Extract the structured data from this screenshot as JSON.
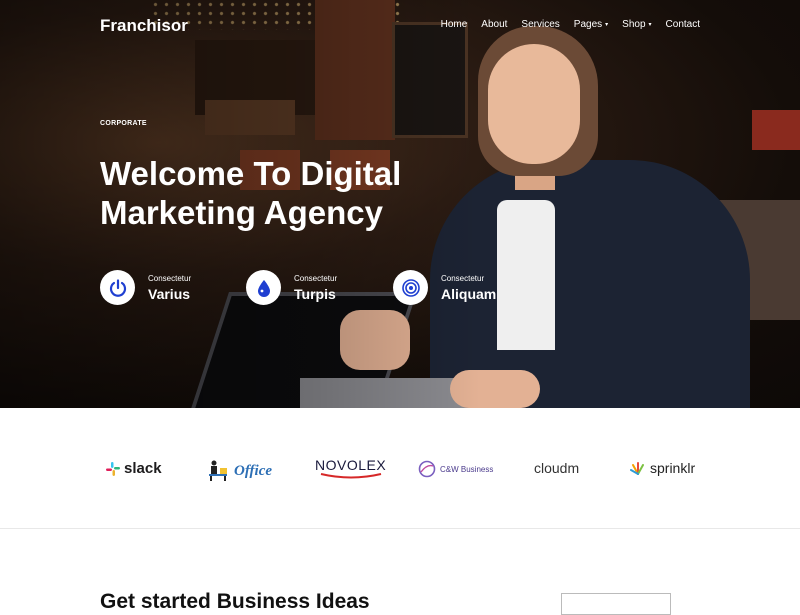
{
  "brand": "Franchisor",
  "nav": {
    "items": [
      {
        "label": "Home"
      },
      {
        "label": "About"
      },
      {
        "label": "Services"
      },
      {
        "label": "Pages",
        "caret": "▾"
      },
      {
        "label": "Shop",
        "caret": "▾"
      },
      {
        "label": "Contact"
      }
    ]
  },
  "hero": {
    "eyebrow": "CORPORATE",
    "headline": "Welcome To Digital Marketing Agency",
    "features": [
      {
        "small": "Consectetur",
        "big": "Varius",
        "icon": "power-icon"
      },
      {
        "small": "Consectetur",
        "big": "Turpis",
        "icon": "drop-icon"
      },
      {
        "small": "Consectetur",
        "big": "Aliquam",
        "icon": "target-icon"
      }
    ]
  },
  "logos": [
    {
      "name": "slack",
      "text": "slack"
    },
    {
      "name": "office",
      "text": "Office"
    },
    {
      "name": "novolex",
      "text": "NOVOLEX"
    },
    {
      "name": "cw",
      "text": "C&W Business"
    },
    {
      "name": "cloudm",
      "text": "cloudm"
    },
    {
      "name": "sprinklr",
      "text": "sprinklr"
    }
  ],
  "section": {
    "title": "Get started Business Ideas"
  },
  "colors": {
    "accent": "#1f3fd1",
    "heading": "#111111"
  }
}
